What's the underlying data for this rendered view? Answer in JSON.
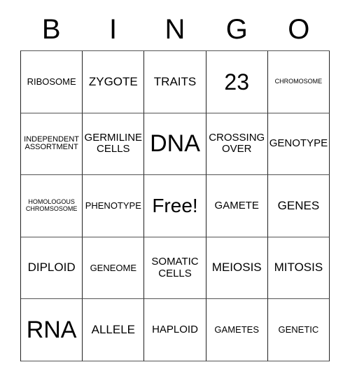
{
  "card": {
    "header_letters": [
      "B",
      "I",
      "N",
      "G",
      "O"
    ],
    "rows": [
      [
        {
          "text": "RIBOSOME",
          "size": "sm"
        },
        {
          "text": "ZYGOTE",
          "size": "lg"
        },
        {
          "text": "TRAITS",
          "size": "lg"
        },
        {
          "text": "23",
          "size": "xxl"
        },
        {
          "text": "CHROMOSOME",
          "size": "xxs"
        }
      ],
      [
        {
          "text": "INDEPENDENT\nASSORTMENT",
          "size": "xs"
        },
        {
          "text": "GERMILINE\nCELLS",
          "size": "md"
        },
        {
          "text": "DNA",
          "size": "huge"
        },
        {
          "text": "CROSSING\nOVER",
          "size": "md"
        },
        {
          "text": "GENOTYPE",
          "size": "md"
        }
      ],
      [
        {
          "text": "HOMOLOGOUS\nCHROMSOSOME",
          "size": "xxs"
        },
        {
          "text": "PHENOTYPE",
          "size": "sm"
        },
        {
          "text": "Free!",
          "size": "xl"
        },
        {
          "text": "GAMETE",
          "size": "md"
        },
        {
          "text": "GENES",
          "size": "lg"
        }
      ],
      [
        {
          "text": "DIPLOID",
          "size": "lg"
        },
        {
          "text": "GENEOME",
          "size": "sm"
        },
        {
          "text": "SOMATIC\nCELLS",
          "size": "md"
        },
        {
          "text": "MEIOSIS",
          "size": "lg"
        },
        {
          "text": "MITOSIS",
          "size": "lg"
        }
      ],
      [
        {
          "text": "RNA",
          "size": "huge"
        },
        {
          "text": "ALLELE",
          "size": "lg"
        },
        {
          "text": "HAPLOID",
          "size": "md"
        },
        {
          "text": "GAMETES",
          "size": "sm"
        },
        {
          "text": "GENETIC",
          "size": "sm"
        }
      ]
    ]
  }
}
